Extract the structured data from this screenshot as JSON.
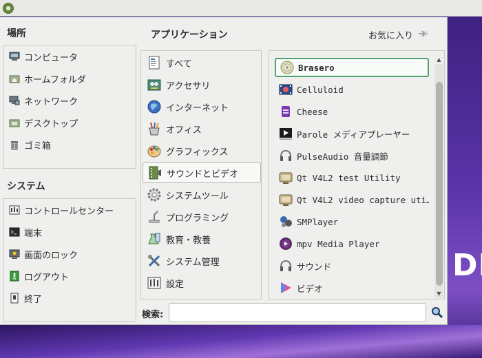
{
  "desktop": {
    "wallpaper_text": "DE"
  },
  "menu": {
    "places": {
      "title": "場所",
      "items": [
        {
          "label": "コンピュータ",
          "icon": "computer-icon"
        },
        {
          "label": "ホームフォルダ",
          "icon": "home-folder-icon"
        },
        {
          "label": "ネットワーク",
          "icon": "network-icon"
        },
        {
          "label": "デスクトップ",
          "icon": "desktop-folder-icon"
        },
        {
          "label": "ゴミ箱",
          "icon": "trash-icon"
        }
      ]
    },
    "system": {
      "title": "システム",
      "items": [
        {
          "label": "コントロールセンター",
          "icon": "control-center-icon"
        },
        {
          "label": "端末",
          "icon": "terminal-icon"
        },
        {
          "label": "画面のロック",
          "icon": "lock-screen-icon"
        },
        {
          "label": "ログアウト",
          "icon": "logout-icon"
        },
        {
          "label": "終了",
          "icon": "shutdown-icon"
        }
      ]
    },
    "applications": {
      "title": "アプリケーション",
      "favorites_label": "お気に入り",
      "categories": [
        {
          "label": "すべて",
          "icon": "all-apps-icon"
        },
        {
          "label": "アクセサリ",
          "icon": "accessories-icon"
        },
        {
          "label": "インターネット",
          "icon": "internet-icon"
        },
        {
          "label": "オフィス",
          "icon": "office-icon"
        },
        {
          "label": "グラフィックス",
          "icon": "graphics-icon"
        },
        {
          "label": "サウンドとビデオ",
          "icon": "sound-video-icon",
          "active": true
        },
        {
          "label": "システムツール",
          "icon": "system-tools-icon"
        },
        {
          "label": "プログラミング",
          "icon": "programming-icon"
        },
        {
          "label": "教育・教養",
          "icon": "education-icon"
        },
        {
          "label": "システム管理",
          "icon": "administration-icon"
        },
        {
          "label": "設定",
          "icon": "settings-icon"
        }
      ],
      "apps": [
        {
          "label": "Brasero",
          "icon": "brasero-disc-icon",
          "selected": true
        },
        {
          "label": "Celluloid",
          "icon": "celluloid-icon"
        },
        {
          "label": "Cheese",
          "icon": "cheese-icon"
        },
        {
          "label": "Parole メディアプレーヤー",
          "icon": "parole-icon"
        },
        {
          "label": "PulseAudio 音量調節",
          "icon": "pulseaudio-icon"
        },
        {
          "label": "Qt V4L2 test Utility",
          "icon": "qv4l2-icon"
        },
        {
          "label": "Qt V4L2 video capture uti…",
          "icon": "qvidcap-icon"
        },
        {
          "label": "SMPlayer",
          "icon": "smplayer-icon"
        },
        {
          "label": "mpv Media Player",
          "icon": "mpv-icon"
        },
        {
          "label": "サウンド",
          "icon": "sound-icon"
        },
        {
          "label": "ビデオ",
          "icon": "video-icon"
        }
      ]
    },
    "search": {
      "label": "検索:",
      "value": "",
      "placeholder": ""
    }
  },
  "colors": {
    "selection_border": "#4fa36e",
    "panel_bg": "#efefed",
    "wallpaper_purple": "#5a34a8"
  }
}
